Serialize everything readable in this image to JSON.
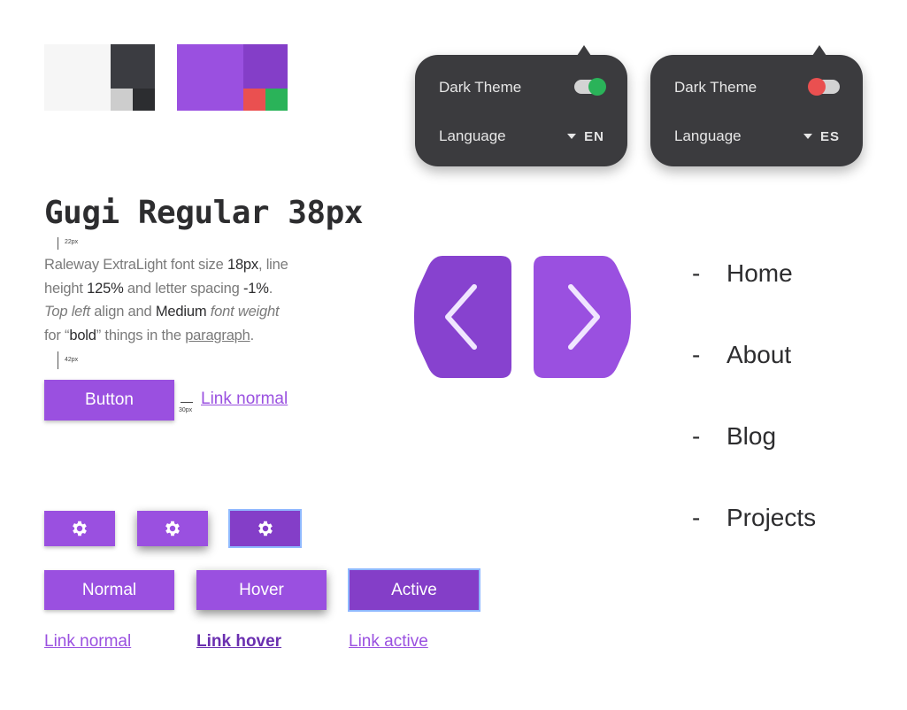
{
  "palette": {
    "light": "#f6f6f6",
    "dark": "#3b3c41",
    "light_gray": "#cdcdcd",
    "darker": "#2c2d30",
    "purple": "#9a50e0",
    "purple_dark": "#843ec8",
    "red": "#ea5050",
    "green": "#2ab359"
  },
  "settings_cards": [
    {
      "theme_label": "Dark Theme",
      "toggle_state": "on",
      "toggle_color": "#2ab359",
      "language_label": "Language",
      "language_value": "EN"
    },
    {
      "theme_label": "Dark Theme",
      "toggle_state": "off",
      "toggle_color": "#ea5050",
      "language_label": "Language",
      "language_value": "ES"
    }
  ],
  "typography": {
    "heading": "Gugi Regular 38px",
    "spacing_top_label": "22px",
    "paragraph": {
      "p1": "Raleway ExtraLight font size ",
      "v1": "18px",
      "p2": ", line height ",
      "v2": "125%",
      "p3": " and letter spacing ",
      "v3": "-1%",
      "p4": ".",
      "i1": "Top left",
      "p5": " align and ",
      "v4": "Medium",
      "i2": " font weight",
      "p6": "for “",
      "v5": "bold",
      "p7": "” things in the ",
      "u1": "paragraph",
      "p8": "."
    },
    "spacing_bottom_label": "42px",
    "button_label": "Button",
    "gap_label": "30px",
    "link_label": "Link normal"
  },
  "icon_buttons": [
    {
      "state": "normal",
      "icon": "gear-icon"
    },
    {
      "state": "hover",
      "icon": "gear-icon"
    },
    {
      "state": "active",
      "icon": "gear-icon"
    }
  ],
  "state_buttons": {
    "normal": "Normal",
    "hover": "Hover",
    "active": "Active"
  },
  "state_links": {
    "normal": "Link normal",
    "hover": "Link hover",
    "active": "Link active"
  },
  "nav_arrows": {
    "prev_icon": "chevron-left-icon",
    "next_icon": "chevron-right-icon"
  },
  "menu": {
    "dash": "-",
    "items": [
      "Home",
      "About",
      "Blog",
      "Projects"
    ]
  }
}
